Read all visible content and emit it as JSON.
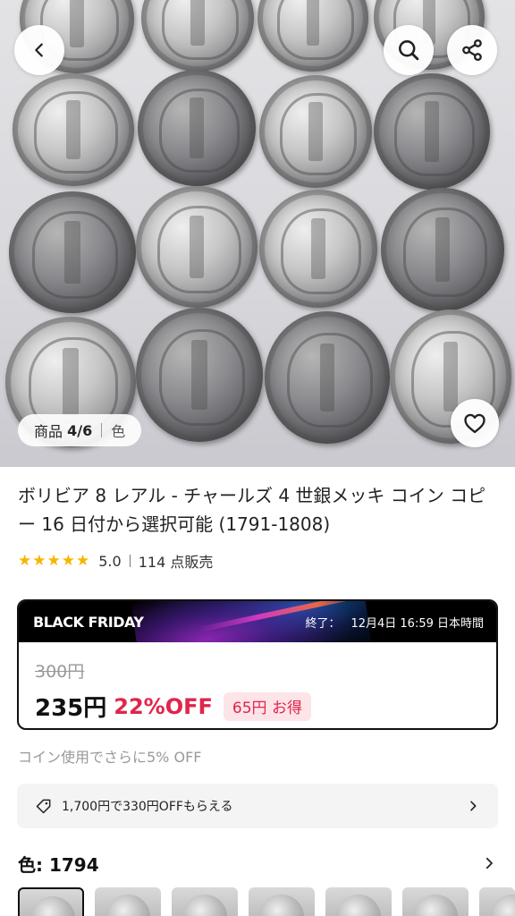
{
  "gallery": {
    "counter_label": "商品",
    "counter_value": "4/6",
    "color_label": "色"
  },
  "product": {
    "title": "ボリビア 8 レアル - チャールズ 4 世銀メッキ コイン コピー 16 日付から選択可能 (1791-1808)",
    "rating": "5.0",
    "stars": 5,
    "sold": "114 点販売"
  },
  "promo": {
    "title": "BLACK FRIDAY",
    "end_label": "終了：",
    "end_time": "12月4日 16:59 日本時間",
    "original_price": "300円",
    "sale_price": "235円",
    "discount": "22%OFF",
    "savings": "65円 お得"
  },
  "coin_note": "コイン使用でさらに5% OFF",
  "coupon": {
    "text": "1,700円で330円OFFもらえる"
  },
  "variant": {
    "label": "色: 1794"
  },
  "icons": {
    "back": "chevron-left-icon",
    "search": "search-icon",
    "share": "share-icon",
    "favorite": "heart-icon",
    "coupon": "tag-icon",
    "arrow": "chevron-right-icon"
  },
  "colors": {
    "accent": "#e0254b",
    "star": "#f7b500",
    "badge_bg": "#fde4e8"
  }
}
